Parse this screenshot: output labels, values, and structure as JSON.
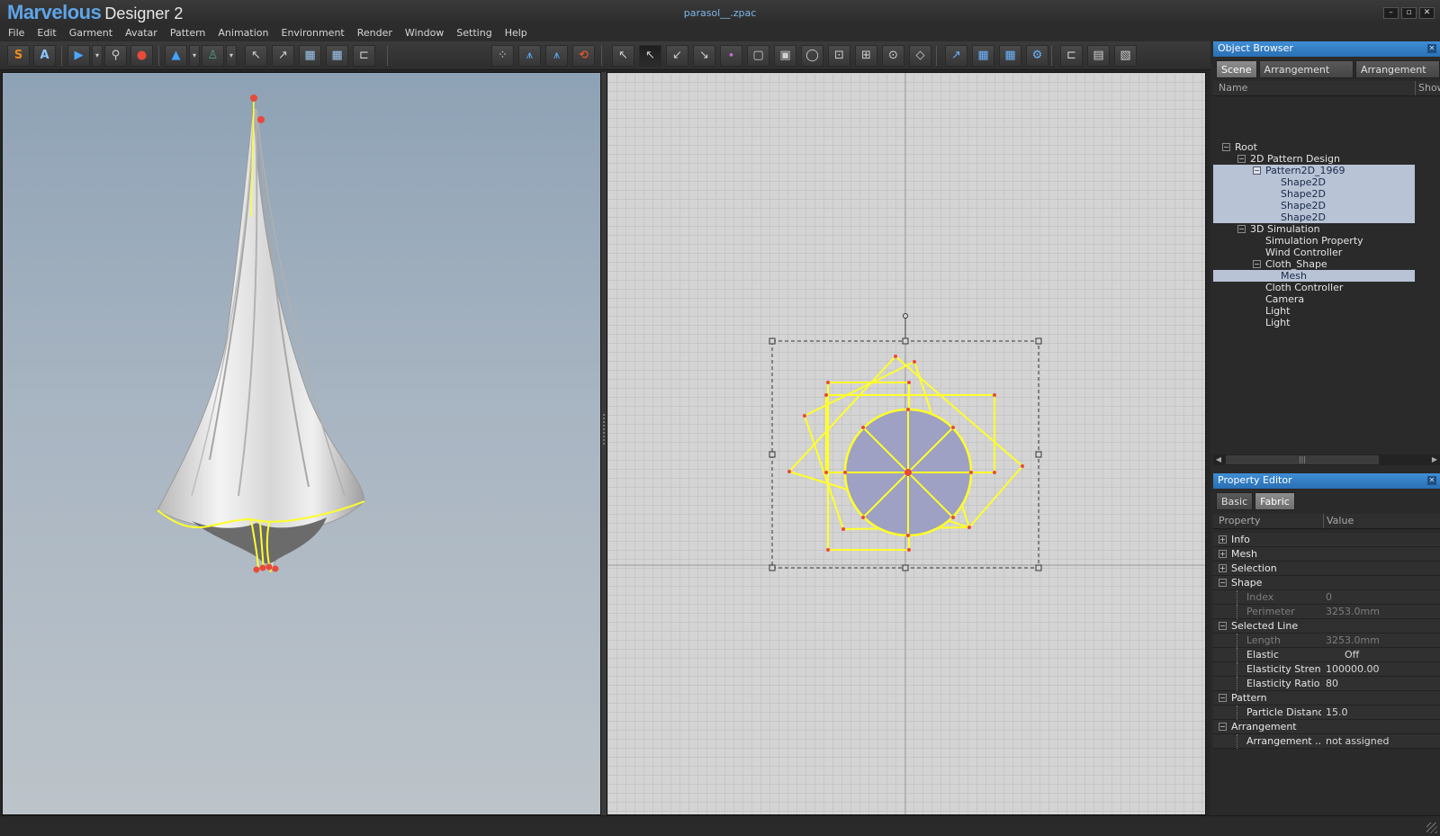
{
  "app": {
    "brand": "Marvelous",
    "product": "Designer 2",
    "document": "parasol__.zpac"
  },
  "window_controls": [
    "–",
    "▫",
    "✕"
  ],
  "menu": [
    "File",
    "Edit",
    "Garment",
    "Avatar",
    "Pattern",
    "Animation",
    "Environment",
    "Render",
    "Window",
    "Setting",
    "Help"
  ],
  "toolbar": {
    "sim_label": "S",
    "anim_label": "A"
  },
  "object_browser": {
    "title": "Object Browser",
    "tabs": [
      "Scene",
      "Arrangement Point",
      "Arrangement BV"
    ],
    "columns": {
      "name": "Name",
      "show": "Show"
    },
    "tree": [
      {
        "label": "Root",
        "toggle": "−",
        "depth": 0,
        "selected": false
      },
      {
        "label": "2D Pattern Design",
        "toggle": "−",
        "depth": 1,
        "selected": false
      },
      {
        "label": "Pattern2D_1969",
        "toggle": "−",
        "depth": 2,
        "selected": true
      },
      {
        "label": "Shape2D",
        "toggle": "",
        "depth": 3,
        "selected": true
      },
      {
        "label": "Shape2D",
        "toggle": "",
        "depth": 3,
        "selected": true
      },
      {
        "label": "Shape2D",
        "toggle": "",
        "depth": 3,
        "selected": true
      },
      {
        "label": "Shape2D",
        "toggle": "",
        "depth": 3,
        "selected": true
      },
      {
        "label": "3D Simulation",
        "toggle": "−",
        "depth": 1,
        "selected": false
      },
      {
        "label": "Simulation Property",
        "toggle": "",
        "depth": 2,
        "selected": false
      },
      {
        "label": "Wind Controller",
        "toggle": "",
        "depth": 2,
        "selected": false
      },
      {
        "label": "Cloth_Shape",
        "toggle": "−",
        "depth": 2,
        "selected": false
      },
      {
        "label": "Mesh",
        "toggle": "",
        "depth": 3,
        "selected": true
      },
      {
        "label": "Cloth Controller",
        "toggle": "",
        "depth": 2,
        "selected": false
      },
      {
        "label": "Camera",
        "toggle": "",
        "depth": 2,
        "selected": false
      },
      {
        "label": "Light",
        "toggle": "",
        "depth": 2,
        "selected": false
      },
      {
        "label": "Light",
        "toggle": "",
        "depth": 2,
        "selected": false
      }
    ]
  },
  "property_editor": {
    "title": "Property Editor",
    "tabs": [
      "Basic",
      "Fabric"
    ],
    "columns": {
      "property": "Property",
      "value": "Value"
    },
    "rows": [
      {
        "kind": "group",
        "toggle": "+",
        "name": "Info",
        "value": ""
      },
      {
        "kind": "group",
        "toggle": "+",
        "name": "Mesh",
        "value": ""
      },
      {
        "kind": "group",
        "toggle": "+",
        "name": "Selection",
        "value": ""
      },
      {
        "kind": "group",
        "toggle": "−",
        "name": "Shape",
        "value": ""
      },
      {
        "kind": "dim",
        "toggle": "",
        "name": "Index",
        "value": "0"
      },
      {
        "kind": "dim",
        "toggle": "",
        "name": "Perimeter",
        "value": "3253.0mm"
      },
      {
        "kind": "group",
        "toggle": "−",
        "name": "Selected Line",
        "value": ""
      },
      {
        "kind": "dim",
        "toggle": "",
        "name": "Length",
        "value": "3253.0mm"
      },
      {
        "kind": "sub",
        "toggle": "",
        "name": "Elastic",
        "value": "Off"
      },
      {
        "kind": "sub",
        "toggle": "",
        "name": "Elasticity Stren...",
        "value": "100000.00"
      },
      {
        "kind": "sub",
        "toggle": "",
        "name": "Elasticity Ratio",
        "value": "80"
      },
      {
        "kind": "group",
        "toggle": "−",
        "name": "Pattern",
        "value": ""
      },
      {
        "kind": "sub",
        "toggle": "",
        "name": "Particle Distance",
        "value": "15.0"
      },
      {
        "kind": "group",
        "toggle": "−",
        "name": "Arrangement",
        "value": ""
      },
      {
        "kind": "sub",
        "toggle": "",
        "name": "Arrangement ...",
        "value": "not assigned"
      }
    ]
  },
  "colors": {
    "accent": "#3f8ed6",
    "selection": "#b8c3d6",
    "pattern_outline": "#ffff2a",
    "point": "#e84a3a"
  }
}
